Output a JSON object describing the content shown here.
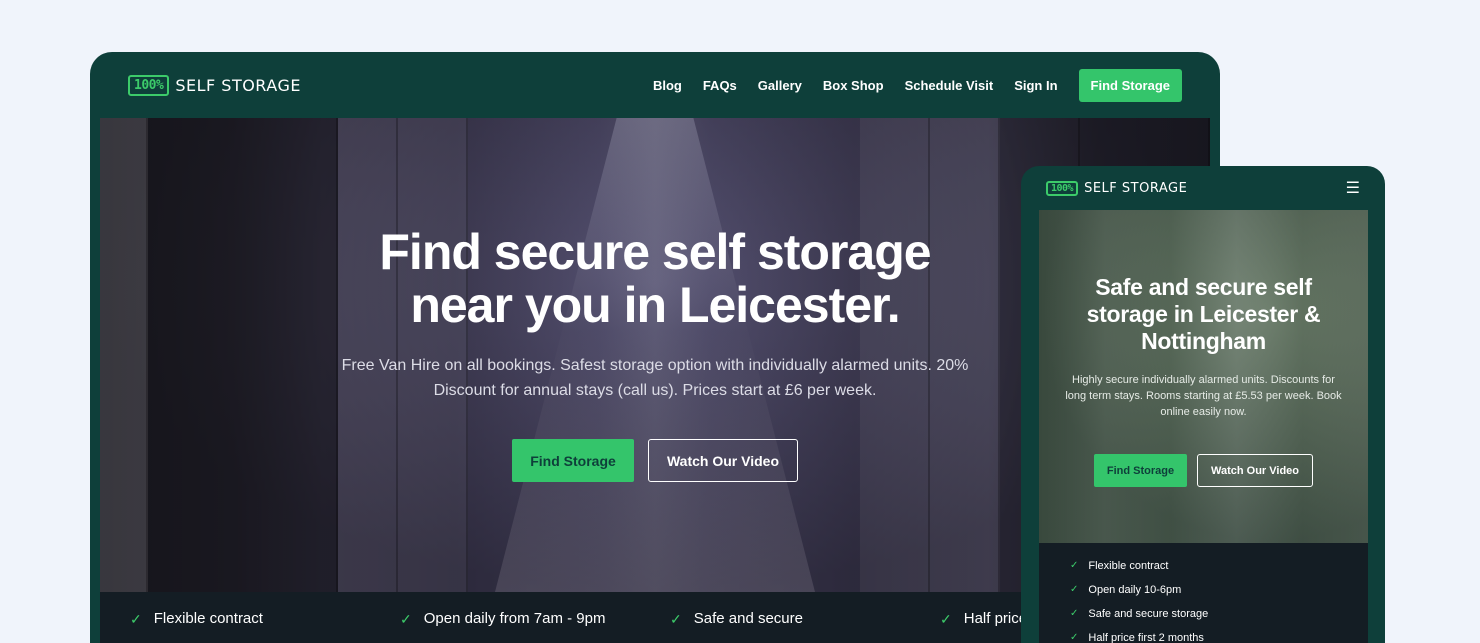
{
  "desktop": {
    "logo": {
      "badge": "100%",
      "text": "SELF STORAGE"
    },
    "nav": {
      "items": [
        "Blog",
        "FAQs",
        "Gallery",
        "Box Shop",
        "Schedule Visit",
        "Sign In"
      ],
      "cta": "Find Storage"
    },
    "hero": {
      "title_line1": "Find secure self storage",
      "title_line2": "near you in Leicester.",
      "subtitle": "Free Van Hire on all bookings. Safest storage option with individually alarmed units. 20% Discount for annual stays (call us). Prices start at £6 per week.",
      "primary_cta": "Find Storage",
      "secondary_cta": "Watch Our Video"
    },
    "features": [
      "Flexible contract",
      "Open daily from 7am - 9pm",
      "Safe and secure",
      "Half price"
    ]
  },
  "mobile": {
    "logo": {
      "badge": "100%",
      "text": "SELF STORAGE"
    },
    "menu_icon": "hamburger-icon",
    "hero": {
      "title": "Safe and secure self storage in Leicester & Nottingham",
      "subtitle": "Highly secure individually alarmed units. Discounts for long term stays. Rooms starting at £5.53 per week. Book online easily now.",
      "primary_cta": "Find Storage",
      "secondary_cta": "Watch Our Video"
    },
    "features": [
      "Flexible contract",
      "Open daily 10-6pm",
      "Safe and secure storage",
      "Half price first 2 months"
    ]
  },
  "colors": {
    "page_bg": "#f0f4fb",
    "frame_bg": "#0e3f3a",
    "accent_green": "#34c56b",
    "features_bg": "#141d24"
  },
  "icons": {
    "check": "check-icon",
    "menu": "hamburger-icon"
  }
}
